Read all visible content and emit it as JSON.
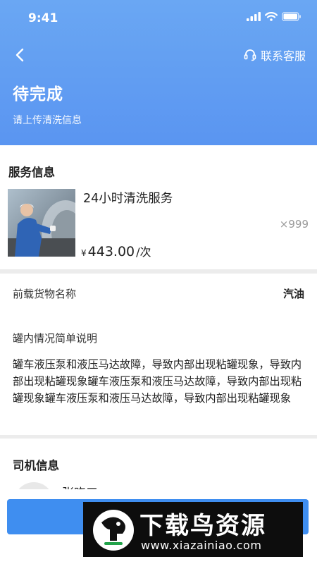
{
  "status_bar": {
    "time": "9:41"
  },
  "header": {
    "back_icon": "chevron-left-icon",
    "support_label": "联系客服",
    "title": "待完成",
    "subtitle": "请上传清洗信息"
  },
  "service": {
    "section_title": "服务信息",
    "name": "24小时清洗服务",
    "quantity": "×999",
    "currency": "¥",
    "price": "443.00",
    "unit": "/次"
  },
  "cargo": {
    "label": "前载货物名称",
    "value": "汽油",
    "desc_label": "罐内情况简单说明",
    "desc_text": "罐车液压泵和液压马达故障，导致内部出现粘罐现象，导致内部出现粘罐现象罐车液压泵和液压马达故障，导致内部出现粘罐现象罐车液压泵和液压马达故障，导致内部出现粘罐现象"
  },
  "driver": {
    "section_title": "司机信息",
    "name": "张晓三"
  },
  "watermark": {
    "name": "下载鸟资源",
    "url": "www.xiazainiao.com"
  },
  "colors": {
    "header_gradient_start": "#6aa7f3",
    "header_gradient_end": "#5a95f1",
    "primary_button": "#3f8ef0"
  }
}
